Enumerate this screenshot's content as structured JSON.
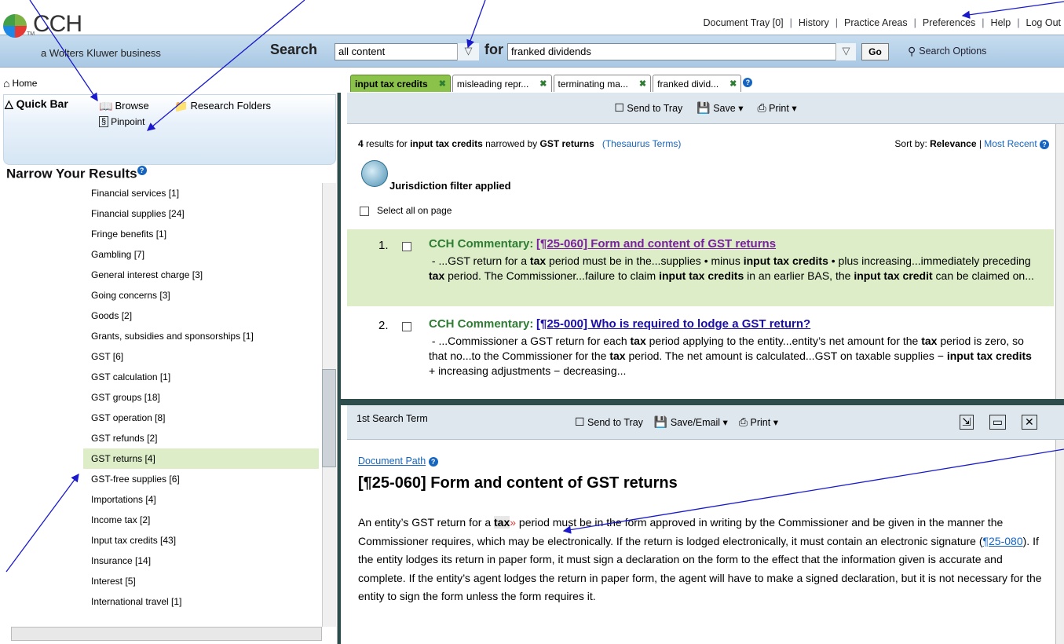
{
  "logo": {
    "brand": "CCH",
    "tm": "TM",
    "subtitle": "a Wolters Kluwer business"
  },
  "top_links": [
    "Document Tray [0]",
    "History",
    "Practice Areas",
    "Preferences",
    "Help",
    "Log Out"
  ],
  "search": {
    "label": "Search",
    "scope_value": "all content",
    "for_label": "for",
    "query_value": "franked dividends",
    "go_label": "Go",
    "options_label": "Search Options"
  },
  "home_label": "Home",
  "tabs": [
    {
      "label": "input tax credits",
      "active": true
    },
    {
      "label": "misleading repr...",
      "active": false
    },
    {
      "label": "terminating ma...",
      "active": false
    },
    {
      "label": "franked divid...",
      "active": false
    }
  ],
  "quickbar": {
    "quick_bar": "Quick Bar",
    "browse": "Browse",
    "research_folders": "Research Folders",
    "pinpoint": "Pinpoint"
  },
  "narrow_title": "Narrow Your Results",
  "facets": [
    "Financial services [1]",
    "Financial supplies [24]",
    "Fringe benefits [1]",
    "Gambling [7]",
    "General interest charge [3]",
    "Going concerns [3]",
    "Goods [2]",
    "Grants, subsidies and sponsorships [1]",
    "GST [6]",
    "GST calculation [1]",
    "GST groups [18]",
    "GST operation [8]",
    "GST refunds [2]",
    "GST returns [4]",
    "GST-free supplies [6]",
    "Importations [4]",
    "Income tax [2]",
    "Input tax credits [43]",
    "Insurance [14]",
    "Interest [5]",
    "International travel [1]"
  ],
  "selected_facet": "GST returns [4]",
  "results_toolbar": {
    "send_to_tray": "Send to Tray",
    "save": "Save",
    "print": "Print"
  },
  "results_summary": {
    "count": "4",
    "results_for": "results for",
    "query": "input tax credits",
    "narrowed_by": "narrowed by",
    "narrow_term": "GST returns",
    "thesaurus": "(Thesaurus Terms)",
    "sort_by": "Sort by:",
    "relevance": "Relevance",
    "most_recent": "Most Recent"
  },
  "jurisdiction": "Jurisdiction filter applied",
  "select_all": "Select all on page",
  "results": [
    {
      "num": "1.",
      "category": "CCH Commentary:",
      "title": "[¶25-060] Form and content of GST returns"
    },
    {
      "num": "2.",
      "category": "CCH Commentary:",
      "title": "[¶25-000] Who is required to lodge a GST return?"
    }
  ],
  "doc_toolbar": {
    "search_term": "1st Search Term",
    "send_to_tray": "Send to Tray",
    "save_email": "Save/Email",
    "print": "Print"
  },
  "doc": {
    "path": "Document Path",
    "title": "[¶25-060] Form and content of GST returns",
    "link_ref": "¶25-080"
  },
  "colors": {
    "accent_green": "#8bc34a",
    "selected_row": "#dcedc8",
    "commentary_green": "#2e7d32",
    "link_blue": "#1a0dab",
    "divider": "#2d4d4d",
    "search_band": "#b7d2e9"
  }
}
